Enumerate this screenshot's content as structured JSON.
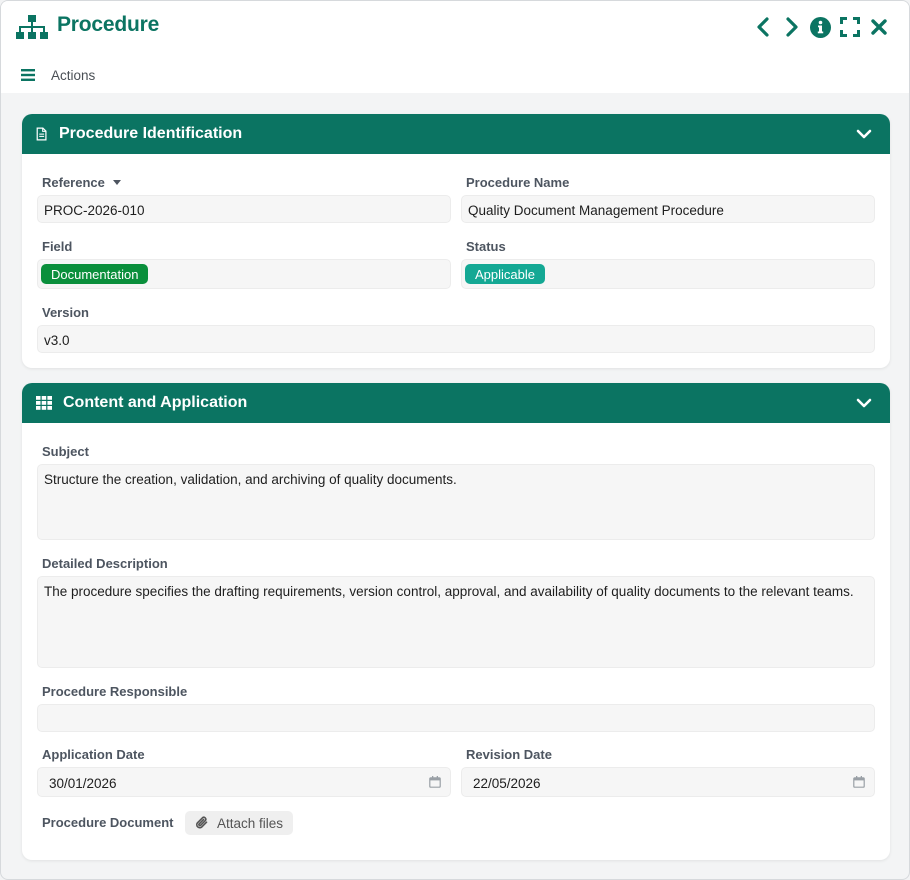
{
  "window": {
    "title": "Procedure",
    "actions_label": "Actions"
  },
  "colors": {
    "primary": "#0b7462",
    "tag_field": "#0a8f3c",
    "tag_status": "#14a894"
  },
  "icons": {
    "app": "sitemap-icon",
    "menu": "hamburger-menu-icon",
    "prev": "chevron-left-icon",
    "next": "chevron-right-icon",
    "info": "info-circle-icon",
    "fullscreen": "expand-icon",
    "close": "close-icon",
    "section1": "document-icon",
    "section2": "table-icon",
    "collapse": "chevron-down-icon",
    "calendar": "calendar-icon",
    "attach": "paperclip-icon"
  },
  "identification": {
    "title": "Procedure Identification",
    "reference_label": "Reference",
    "reference_value": "PROC-2026-010",
    "name_label": "Procedure Name",
    "name_value": "Quality Document Management Procedure",
    "field_label": "Field",
    "field_value": "Documentation",
    "status_label": "Status",
    "status_value": "Applicable",
    "version_label": "Version",
    "version_value": "v3.0"
  },
  "content": {
    "title": "Content and Application",
    "subject_label": "Subject",
    "subject_value": "Structure the creation, validation, and archiving of quality documents.",
    "description_label": "Detailed Description",
    "description_value": "The procedure specifies the drafting requirements, version control, approval, and availability of quality documents to the relevant teams.",
    "responsible_label": "Procedure Responsible",
    "responsible_value": "",
    "application_date_label": "Application Date",
    "application_date_value": "30/01/2026",
    "revision_date_label": "Revision Date",
    "revision_date_value": "22/05/2026",
    "document_label": "Procedure Document",
    "attach_label": "Attach files"
  }
}
